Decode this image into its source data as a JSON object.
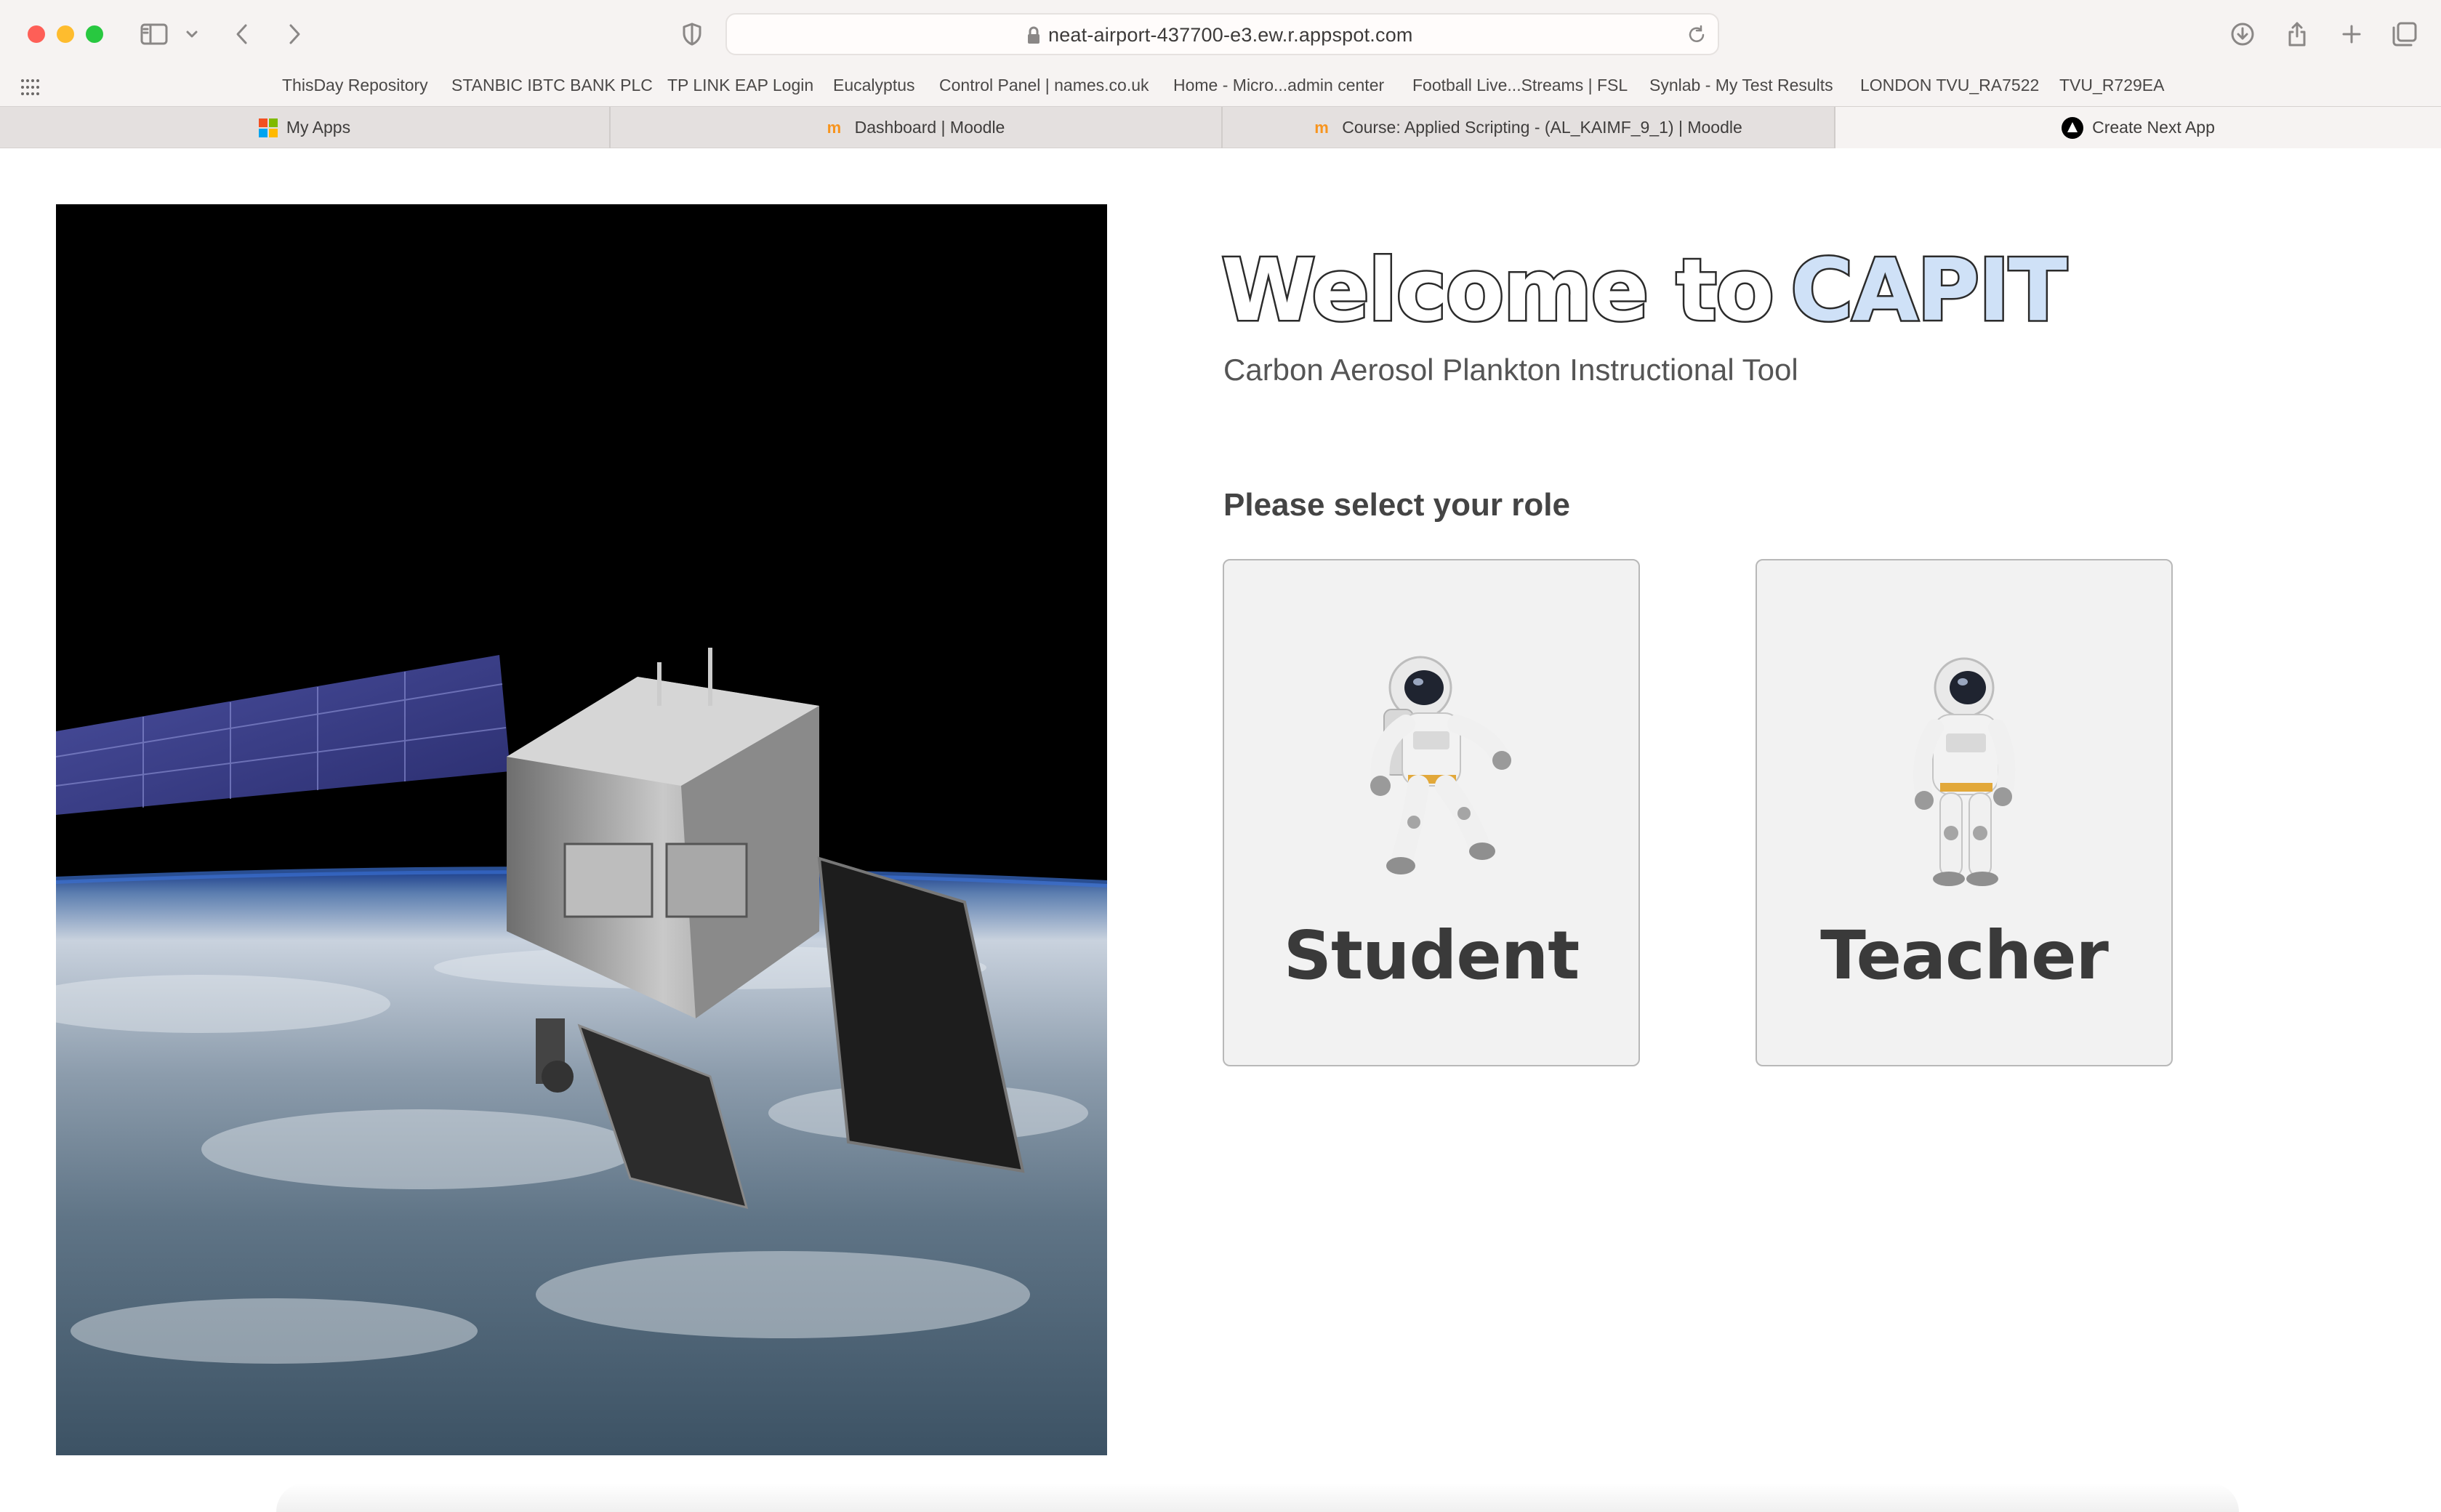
{
  "browser": {
    "url": "neat-airport-437700-e3.ew.r.appspot.com",
    "favorites": [
      "ThisDay Repository",
      "STANBIC IBTC BANK PLC",
      "TP LINK EAP Login",
      "Eucalyptus",
      "Control Panel | names.co.uk",
      "Home - Micro...admin center",
      "Football Live...Streams | FSL",
      "Synlab - My Test Results",
      "LONDON TVU_RA7522",
      "TVU_R729EA"
    ],
    "tabs": [
      {
        "label": "My Apps",
        "icon": "microsoft-icon"
      },
      {
        "label": "Dashboard | Moodle",
        "icon": "moodle-icon"
      },
      {
        "label": "Course: Applied Scripting - (AL_KAIMF_9_1) | Moodle",
        "icon": "moodle-icon"
      },
      {
        "label": "Create Next App",
        "icon": "nextjs-icon",
        "active": true
      }
    ]
  },
  "page": {
    "title_part1": "Welcome to",
    "title_part2": "CAPIT",
    "subtitle": "Carbon Aerosol Plankton Instructional Tool",
    "role_prompt": "Please select your role",
    "roles": [
      {
        "label": "Student",
        "icon": "astronaut-floating-icon"
      },
      {
        "label": "Teacher",
        "icon": "astronaut-standing-icon"
      }
    ],
    "hero_image": "satellite-over-earth"
  },
  "colors": {
    "title_accent": "#cfe1f7",
    "card_bg": "#f2f2f2",
    "card_border": "#b8b8b8",
    "chrome_bg": "#f6f3f2"
  }
}
